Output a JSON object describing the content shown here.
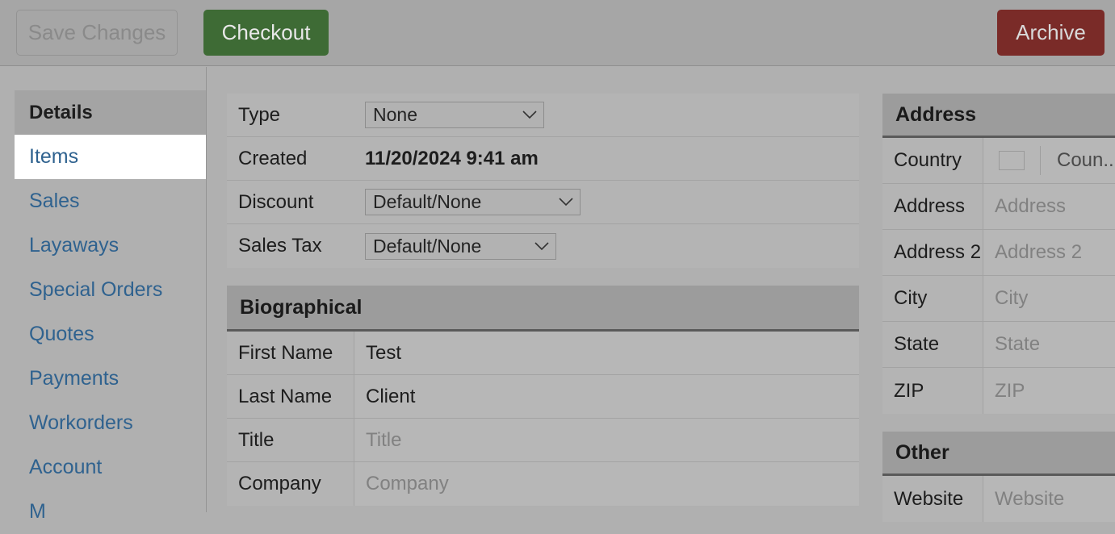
{
  "toolbar": {
    "save_label": "Save Changes",
    "checkout_label": "Checkout",
    "archive_label": "Archive",
    "checkout_color": "#3e6b35",
    "archive_color": "#7a2b28"
  },
  "sidebar": {
    "items": [
      {
        "label": "Details",
        "state": "header"
      },
      {
        "label": "Items",
        "state": "active"
      },
      {
        "label": "Sales",
        "state": "normal"
      },
      {
        "label": "Layaways",
        "state": "normal"
      },
      {
        "label": "Special Orders",
        "state": "normal"
      },
      {
        "label": "Quotes",
        "state": "normal"
      },
      {
        "label": "Payments",
        "state": "normal"
      },
      {
        "label": "Workorders",
        "state": "normal"
      },
      {
        "label": "Account",
        "state": "normal"
      },
      {
        "label": "M",
        "state": "normal"
      }
    ],
    "link_color": "#2f628f"
  },
  "main": {
    "summary": {
      "type": {
        "label": "Type",
        "value": "None"
      },
      "created": {
        "label": "Created",
        "value": "11/20/2024 9:41 am"
      },
      "discount": {
        "label": "Discount",
        "value": "Default/None"
      },
      "sales_tax": {
        "label": "Sales Tax",
        "value": "Default/None"
      }
    },
    "biographical": {
      "title": "Biographical",
      "rows": [
        {
          "label": "First Name",
          "value": "Test",
          "placeholder": ""
        },
        {
          "label": "Last Name",
          "value": "Client",
          "placeholder": ""
        },
        {
          "label": "Title",
          "value": "",
          "placeholder": "Title"
        },
        {
          "label": "Company",
          "value": "",
          "placeholder": "Company"
        }
      ]
    }
  },
  "address": {
    "title": "Address",
    "country": {
      "label": "Country",
      "value": "Coun..."
    },
    "rows": [
      {
        "label": "Address",
        "value": "",
        "placeholder": "Address"
      },
      {
        "label": "Address 2",
        "value": "",
        "placeholder": "Address 2"
      },
      {
        "label": "City",
        "value": "",
        "placeholder": "City"
      },
      {
        "label": "State",
        "value": "",
        "placeholder": "State"
      },
      {
        "label": "ZIP",
        "value": "",
        "placeholder": "ZIP"
      }
    ]
  },
  "other": {
    "title": "Other",
    "rows": [
      {
        "label": "Website",
        "value": "",
        "placeholder": "Website"
      }
    ]
  }
}
